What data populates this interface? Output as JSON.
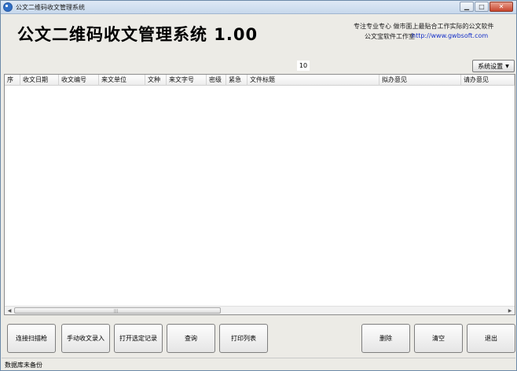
{
  "window": {
    "title": "公文二维码收文管理系统"
  },
  "header": {
    "app_title": "公文二维码收文管理系统 1.00",
    "slogan": "专注专业专心  做市面上最贴合工作实际的公文软件",
    "company": "公文宝软件工作室",
    "website": "http://www.gwbsoft.com",
    "record_count": "10",
    "settings_label": "系统设置"
  },
  "list": {
    "columns": [
      "序",
      "收文日期",
      "收文编号",
      "来文单位",
      "文种",
      "来文字号",
      "密级",
      "紧急",
      "文件标题",
      "拟办意见",
      "请办意见"
    ]
  },
  "buttons": {
    "scanner": "连接扫描枪",
    "manual_entry": "手动收文录入",
    "open_selected": "打开选定记录",
    "query": "查询",
    "print_list": "打印列表",
    "delete": "删除",
    "clear": "清空",
    "exit": "退出"
  },
  "status": {
    "text": "数据库未备份"
  },
  "icons": [
    "app-icon",
    "minimize-icon",
    "maximize-icon",
    "close-icon",
    "dropdown-caret-icon",
    "scroll-left-icon",
    "scroll-right-icon"
  ]
}
